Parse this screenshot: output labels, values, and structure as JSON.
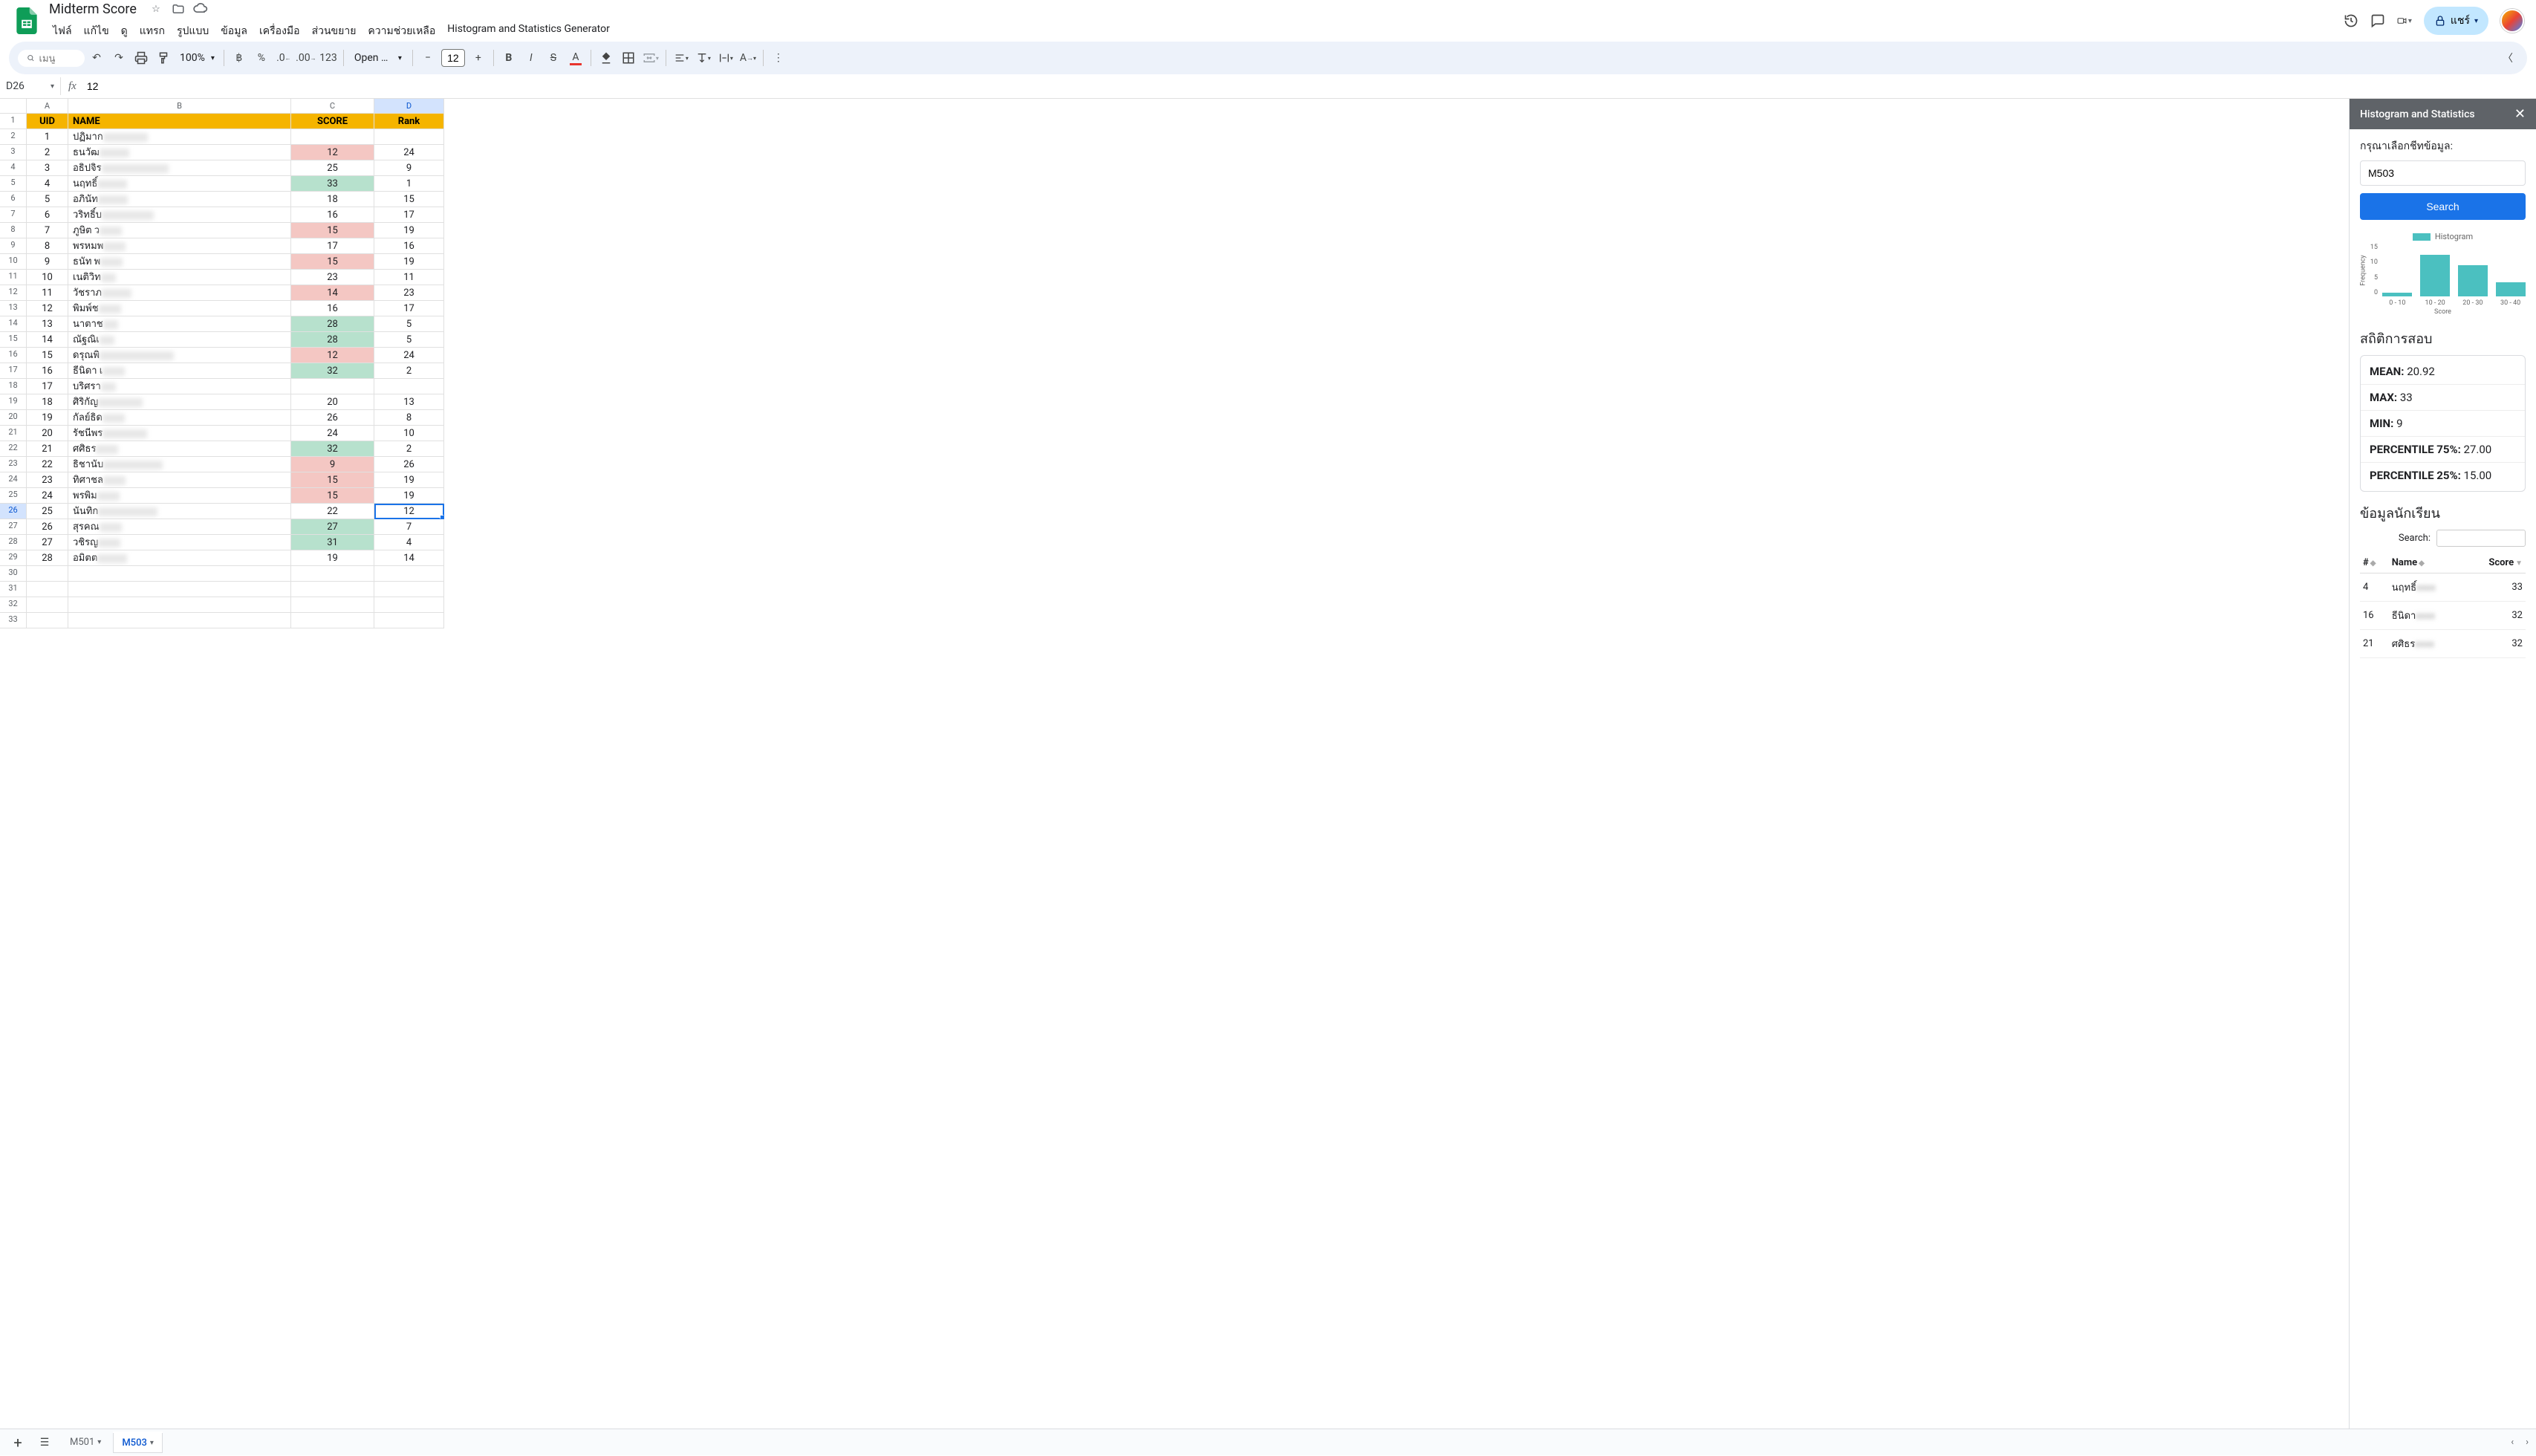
{
  "doc": {
    "title": "Midterm Score"
  },
  "menus": [
    "ไฟล์",
    "แก้ไข",
    "ดู",
    "แทรก",
    "รูปแบบ",
    "ข้อมูล",
    "เครื่องมือ",
    "ส่วนขยาย",
    "ความช่วยเหลือ",
    "Histogram and Statistics Generator"
  ],
  "share_label": "แชร์",
  "search_placeholder": "เมนู",
  "zoom": "100%",
  "font_name": "Open …",
  "font_size": "12",
  "name_box": "D26",
  "formula_value": "12",
  "columns": [
    "A",
    "B",
    "C",
    "D"
  ],
  "headers": {
    "uid": "UID",
    "name": "NAME",
    "score": "SCORE",
    "rank": "Rank"
  },
  "selected": {
    "row": 26,
    "col": "D"
  },
  "rows": [
    {
      "r": 2,
      "uid": 1,
      "name": "ปฏิมาก",
      "nblur": 60,
      "score": "",
      "rank": "",
      "scoreColor": ""
    },
    {
      "r": 3,
      "uid": 2,
      "name": "ธนวัฒ",
      "nblur": 40,
      "score": 12,
      "rank": 24,
      "scoreColor": "red"
    },
    {
      "r": 4,
      "uid": 3,
      "name": "อธิปจิร",
      "nblur": 90,
      "score": 25,
      "rank": 9,
      "scoreColor": ""
    },
    {
      "r": 5,
      "uid": 4,
      "name": "นฤทธิ์",
      "nblur": 40,
      "score": 33,
      "rank": 1,
      "scoreColor": "green"
    },
    {
      "r": 6,
      "uid": 5,
      "name": "อภินัท",
      "nblur": 40,
      "score": 18,
      "rank": 15,
      "scoreColor": ""
    },
    {
      "r": 7,
      "uid": 6,
      "name": "วริทธิ์บ",
      "nblur": 70,
      "score": 16,
      "rank": 17,
      "scoreColor": ""
    },
    {
      "r": 8,
      "uid": 7,
      "name": "ภูษิต ว",
      "nblur": 30,
      "score": 15,
      "rank": 19,
      "scoreColor": "red"
    },
    {
      "r": 9,
      "uid": 8,
      "name": "พรหมพ",
      "nblur": 30,
      "score": 17,
      "rank": 16,
      "scoreColor": ""
    },
    {
      "r": 10,
      "uid": 9,
      "name": "ธนัท พ",
      "nblur": 30,
      "score": 15,
      "rank": 19,
      "scoreColor": "red"
    },
    {
      "r": 11,
      "uid": 10,
      "name": "เนติวิท",
      "nblur": 20,
      "score": 23,
      "rank": 11,
      "scoreColor": ""
    },
    {
      "r": 12,
      "uid": 11,
      "name": "วัชราภ",
      "nblur": 40,
      "score": 14,
      "rank": 23,
      "scoreColor": "red"
    },
    {
      "r": 13,
      "uid": 12,
      "name": "พิมพ์ช",
      "nblur": 30,
      "score": 16,
      "rank": 17,
      "scoreColor": ""
    },
    {
      "r": 14,
      "uid": 13,
      "name": "นาตาช",
      "nblur": 20,
      "score": 28,
      "rank": 5,
      "scoreColor": "green"
    },
    {
      "r": 15,
      "uid": 14,
      "name": "ณัฐณิเ",
      "nblur": 20,
      "score": 28,
      "rank": 5,
      "scoreColor": "green"
    },
    {
      "r": 16,
      "uid": 15,
      "name": "ดรุณพิ",
      "nblur": 100,
      "score": 12,
      "rank": 24,
      "scoreColor": "red"
    },
    {
      "r": 17,
      "uid": 16,
      "name": "ธีนิดา เ",
      "nblur": 30,
      "score": 32,
      "rank": 2,
      "scoreColor": "green"
    },
    {
      "r": 18,
      "uid": 17,
      "name": "บริศรา",
      "nblur": 20,
      "score": "",
      "rank": "",
      "scoreColor": ""
    },
    {
      "r": 19,
      "uid": 18,
      "name": "ศิริกัญ",
      "nblur": 60,
      "score": 20,
      "rank": 13,
      "scoreColor": ""
    },
    {
      "r": 20,
      "uid": 19,
      "name": "กัลย์ธิด",
      "nblur": 30,
      "score": 26,
      "rank": 8,
      "scoreColor": ""
    },
    {
      "r": 21,
      "uid": 20,
      "name": "รัชนีพร",
      "nblur": 60,
      "score": 24,
      "rank": 10,
      "scoreColor": ""
    },
    {
      "r": 22,
      "uid": 21,
      "name": "ศศิธร",
      "nblur": 30,
      "score": 32,
      "rank": 2,
      "scoreColor": "green"
    },
    {
      "r": 23,
      "uid": 22,
      "name": "ธิชานับ",
      "nblur": 80,
      "score": 9,
      "rank": 26,
      "scoreColor": "red"
    },
    {
      "r": 24,
      "uid": 23,
      "name": "ทิศาชล",
      "nblur": 30,
      "score": 15,
      "rank": 19,
      "scoreColor": "red"
    },
    {
      "r": 25,
      "uid": 24,
      "name": "พรพิม",
      "nblur": 30,
      "score": 15,
      "rank": 19,
      "scoreColor": "red"
    },
    {
      "r": 26,
      "uid": 25,
      "name": "นันทิก",
      "nblur": 80,
      "score": 22,
      "rank": 12,
      "scoreColor": ""
    },
    {
      "r": 27,
      "uid": 26,
      "name": "สุรคณ",
      "nblur": 30,
      "score": 27,
      "rank": 7,
      "scoreColor": "green"
    },
    {
      "r": 28,
      "uid": 27,
      "name": "วชิรญ",
      "nblur": 30,
      "score": 31,
      "rank": 4,
      "scoreColor": "green"
    },
    {
      "r": 29,
      "uid": 28,
      "name": "อมิตต",
      "nblur": 40,
      "score": 19,
      "rank": 14,
      "scoreColor": ""
    }
  ],
  "empty_rows": [
    30,
    31,
    32,
    33
  ],
  "sidebar": {
    "title": "Histogram and Statistics",
    "prompt": "กรุณาเลือกชีทข้อมูล:",
    "input_value": "M503",
    "search_btn": "Search",
    "stats_title": "สถิติการสอบ",
    "stats": [
      {
        "label": "MEAN:",
        "value": "20.92"
      },
      {
        "label": "MAX:",
        "value": "33"
      },
      {
        "label": "MIN:",
        "value": "9"
      },
      {
        "label": "PERCENTILE 75%:",
        "value": "27.00"
      },
      {
        "label": "PERCENTILE 25%:",
        "value": "15.00"
      }
    ],
    "students_title": "ข้อมูลนักเรียน",
    "search_label": "Search:",
    "table_headers": {
      "num": "#",
      "name": "Name",
      "score": "Score"
    },
    "students": [
      {
        "num": 4,
        "name": "นฤทธิ์",
        "score": 33
      },
      {
        "num": 16,
        "name": "ธีนิดา",
        "score": 32
      },
      {
        "num": 21,
        "name": "ศศิธร",
        "score": 32
      }
    ]
  },
  "chart_data": {
    "type": "bar",
    "title": "Histogram",
    "xlabel": "Score",
    "ylabel": "Frequency",
    "categories": [
      "0 - 10",
      "10 - 20",
      "20 - 30",
      "30 - 40"
    ],
    "values": [
      1,
      12,
      9,
      4
    ],
    "ylim": [
      0,
      15
    ],
    "yticks": [
      0,
      5,
      10,
      15
    ]
  },
  "tabs": [
    {
      "name": "M501",
      "active": false
    },
    {
      "name": "M503",
      "active": true
    }
  ]
}
